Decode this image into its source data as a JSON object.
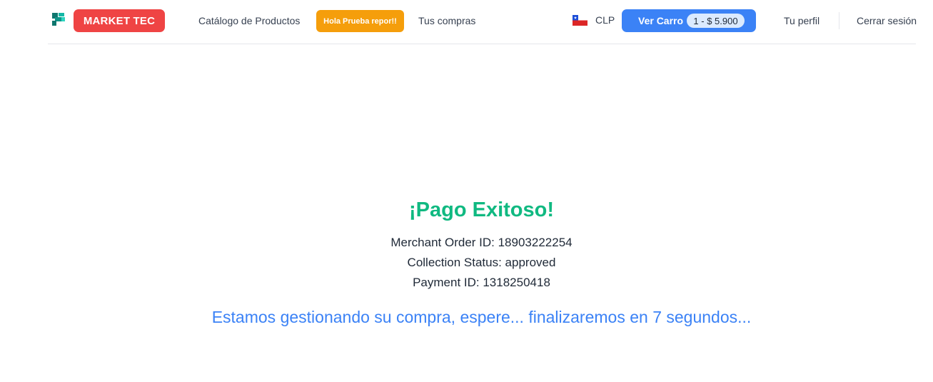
{
  "header": {
    "brand_label": "MARKET TEC",
    "nav": {
      "catalog": "Catálogo de Productos",
      "greeting": "Hola Prueba repor!!",
      "purchases": "Tus compras",
      "currency": "CLP",
      "cart_label": "Ver Carro",
      "cart_badge": "1 - $ 5.900",
      "profile": "Tu perfil",
      "logout": "Cerrar sesión"
    },
    "icons": {
      "logo": "market-tec-logo-icon",
      "flag": "chile-flag-icon"
    }
  },
  "main": {
    "title": "¡Pago Exitoso!",
    "merchant_order": "Merchant Order ID: 18903222254",
    "collection_status": "Collection Status: approved",
    "payment_id": "Payment ID: 1318250418",
    "processing_message": "Estamos gestionando su compra, espere... finalizaremos en 7 segundos..."
  },
  "colors": {
    "brand_red": "#ef4444",
    "greeting_amber": "#f59e0b",
    "cart_blue": "#3b82f6",
    "success_green": "#10b981",
    "message_blue": "#3b82f6"
  }
}
